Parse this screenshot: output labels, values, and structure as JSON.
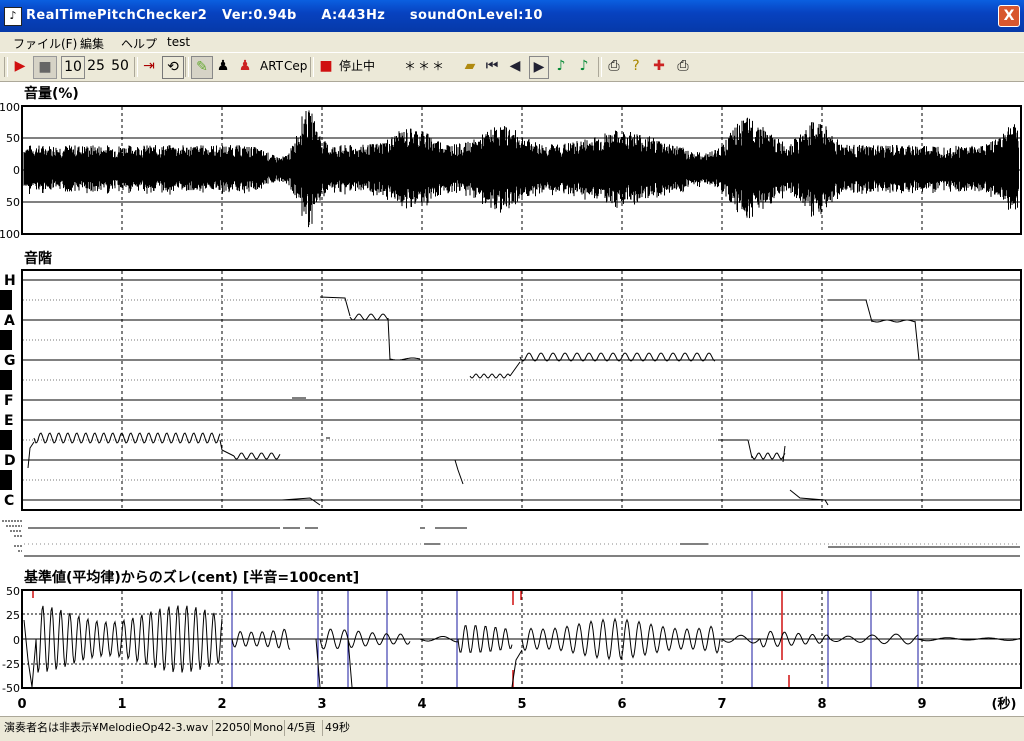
{
  "window": {
    "title": "RealTimePitchChecker2   Ver:0.94b     A:443Hz     soundOnLevel:10",
    "app_icon": "clef-icon",
    "close_label": "X"
  },
  "menu": [
    "ファイル(F)",
    "編集",
    "ヘルプ",
    "test"
  ],
  "toolbar": {
    "play": "▶",
    "stop": "■",
    "zoom_options": [
      "10",
      "25",
      "50"
    ],
    "art_label": "ART",
    "cep_label": "Cep",
    "status_label": "停止中",
    "display": "＊＊＊"
  },
  "panels": {
    "volume_title": "音量(%)",
    "volume_ticks": [
      "100",
      "50",
      "0",
      "50",
      "100"
    ],
    "scale_title": "音階",
    "note_labels": [
      "H",
      "A",
      "G",
      "F",
      "E",
      "D",
      "C"
    ],
    "deviation_title": "基準値(平均律)からのズレ(cent) [半音=100cent]",
    "deviation_ticks": [
      "50",
      "25",
      "0",
      "-25",
      "-50"
    ],
    "time_ticks": [
      "0",
      "1",
      "2",
      "3",
      "4",
      "5",
      "6",
      "7",
      "8",
      "9"
    ],
    "time_unit": "(秒)"
  },
  "status_bar": {
    "file": "演奏者名は非表示¥MelodieOp42-3.wav",
    "rate": "22050",
    "channels": "Mono",
    "page": "4/5頁",
    "duration": "49秒"
  },
  "colors": {
    "title_blue": "#0742c0",
    "accent_red": "#d01010",
    "marker_blue": "#1a1aa0"
  }
}
